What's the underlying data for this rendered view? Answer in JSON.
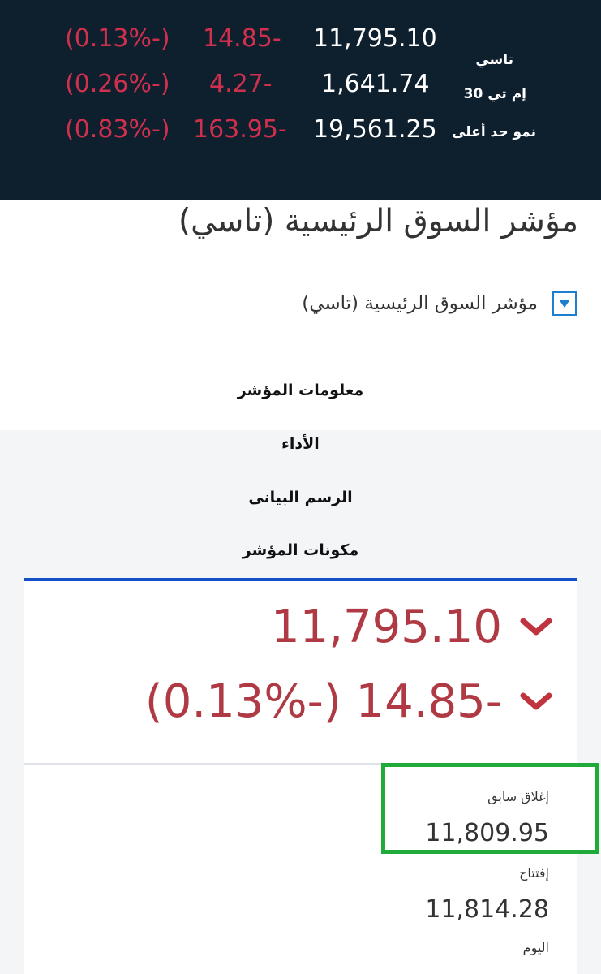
{
  "ticker": {
    "rows": [
      {
        "name": "تاسي",
        "value": "11,795.10",
        "change": "14.85-",
        "percent": "(0.13%-)"
      },
      {
        "name": "إم تي 30",
        "value": "1,641.74",
        "change": "4.27-",
        "percent": "(0.26%-)"
      },
      {
        "name": "نمو حد أعلى",
        "value": "19,561.25",
        "change": "163.95-",
        "percent": "(0.83%-)"
      }
    ],
    "colors": {
      "background": "#0e1f2e",
      "negative": "#d0304e"
    }
  },
  "header": {
    "title": "مؤشر السوق الرئيسية (تاسي)",
    "selector_label": "مؤشر السوق الرئيسية (تاسي)",
    "dropdown_icon": "triangle-down-icon"
  },
  "tabs": [
    {
      "label": "معلومات المؤشر"
    },
    {
      "label": "الأداء"
    },
    {
      "label": "الرسم البيانى"
    },
    {
      "label": "مكونات المؤشر"
    }
  ],
  "summary": {
    "value": "11,795.10",
    "change": "(0.13%-) 14.85-",
    "trend_icon": "chevron-down-icon",
    "color": "#b03a44"
  },
  "stats": {
    "previous_close_label": "إغلاق سابق",
    "previous_close_value": "11,809.95",
    "open_label": "إفتتاح",
    "open_value": "11,814.28",
    "day_label": "اليوم"
  },
  "highlight_color": "#1faa3a"
}
